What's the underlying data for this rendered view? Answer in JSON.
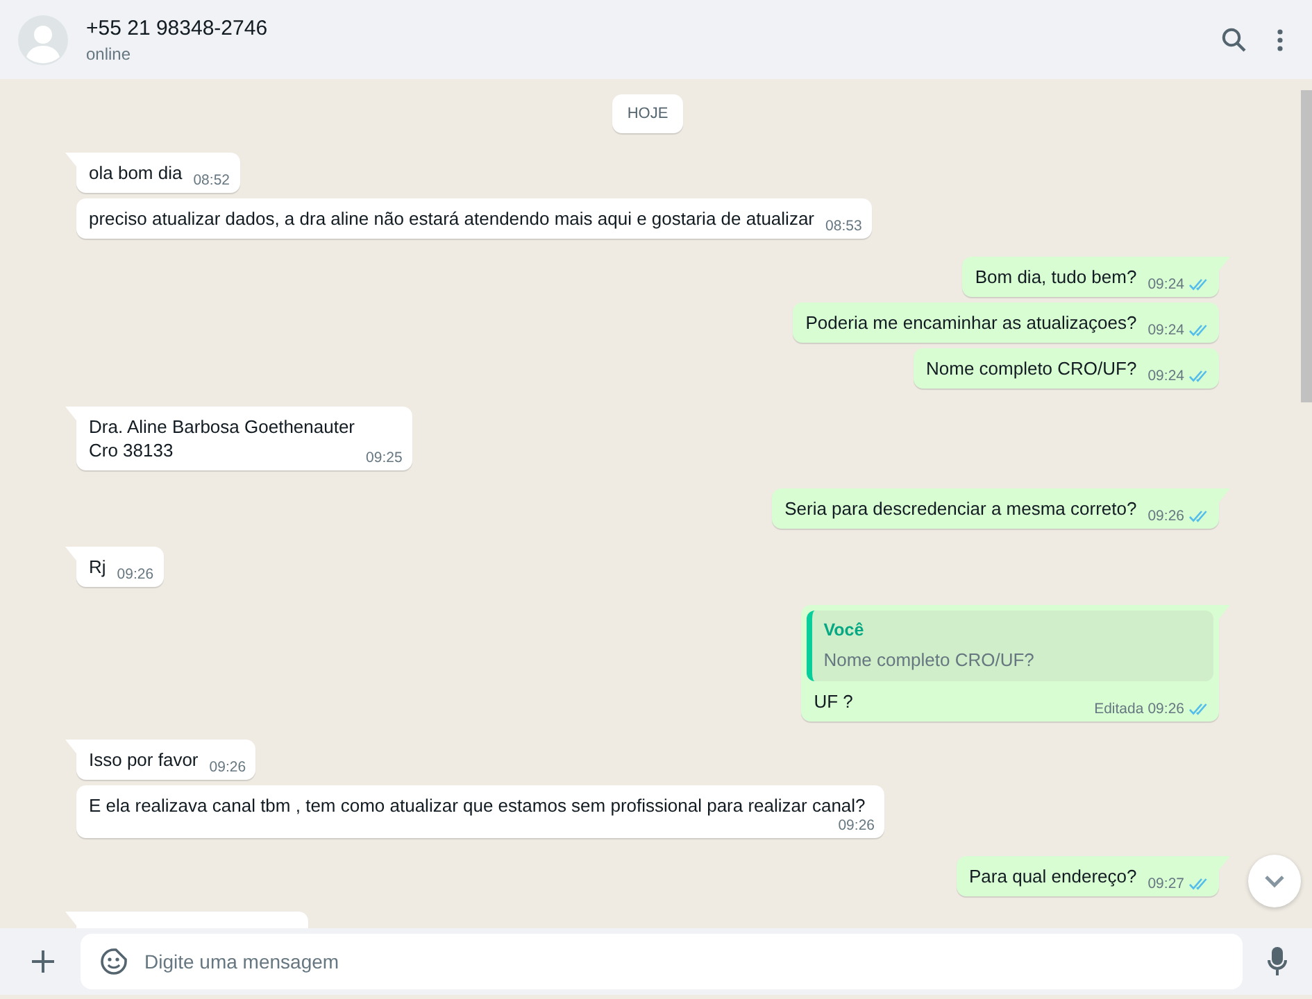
{
  "header": {
    "contact": "+55 21 98348-2746",
    "status": "online"
  },
  "date_chip": "HOJE",
  "messages": [
    {
      "kind": "incoming",
      "tail": true,
      "text": "ola bom dia",
      "time": "08:52"
    },
    {
      "kind": "incoming",
      "tail": false,
      "text": "preciso atualizar dados, a dra aline não estará atendendo mais aqui e gostaria de atualizar",
      "time": "08:53"
    },
    {
      "kind": "outgoing",
      "tail": true,
      "text": "Bom dia, tudo bem?",
      "time": "09:24",
      "read": true
    },
    {
      "kind": "outgoing",
      "tail": false,
      "text": "Poderia me encaminhar as atualizaçoes?",
      "time": "09:24",
      "read": true
    },
    {
      "kind": "outgoing",
      "tail": false,
      "text": "Nome completo CRO/UF?",
      "time": "09:24",
      "read": true
    },
    {
      "kind": "incoming",
      "tail": true,
      "text": "Dra. Aline Barbosa Goethenauter\nCro 38133",
      "time": "09:25"
    },
    {
      "kind": "outgoing",
      "tail": true,
      "text": "Seria para descredenciar a mesma correto?",
      "time": "09:26",
      "read": true
    },
    {
      "kind": "incoming",
      "tail": true,
      "text": "Rj",
      "time": "09:26"
    },
    {
      "kind": "outgoing",
      "tail": true,
      "quote": {
        "author": "Você",
        "text": "Nome completo CRO/UF?"
      },
      "text": "UF ?",
      "edited": "Editada",
      "time": "09:26",
      "read": true
    },
    {
      "kind": "incoming",
      "tail": true,
      "text": "Isso por favor",
      "time": "09:26"
    },
    {
      "kind": "incoming",
      "tail": false,
      "text": "E ela realizava canal tbm , tem como atualizar que estamos sem profissional para realizar canal?",
      "time": "09:26"
    },
    {
      "kind": "outgoing",
      "tail": true,
      "text": "Para qual endereço?",
      "time": "09:27",
      "read": true
    },
    {
      "kind": "incoming",
      "tail": true
    }
  ],
  "composer": {
    "placeholder": "Digite uma mensagem"
  }
}
